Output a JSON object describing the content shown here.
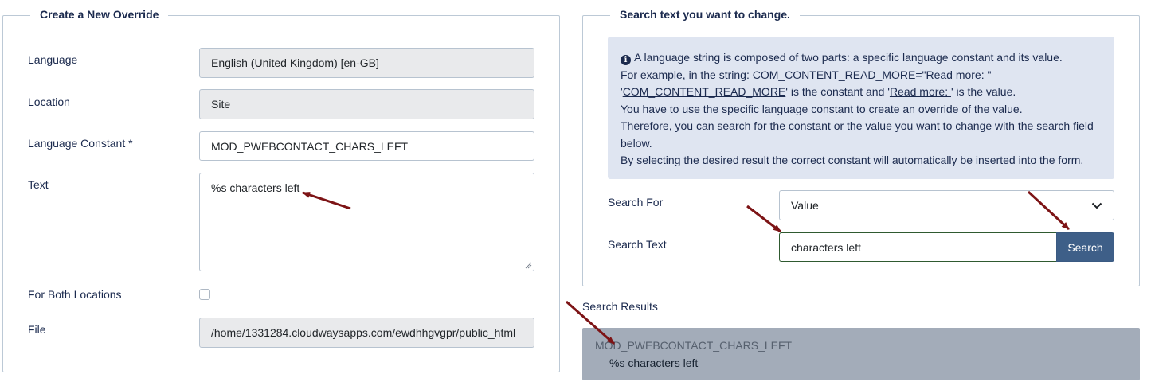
{
  "left_panel": {
    "legend": "Create a New Override",
    "language_label": "Language",
    "language_value": "English (United Kingdom) [en-GB]",
    "location_label": "Location",
    "location_value": "Site",
    "constant_label": "Language Constant *",
    "constant_value": "MOD_PWEBCONTACT_CHARS_LEFT",
    "text_label": "Text",
    "text_value": "%s characters left",
    "both_locations_label": "For Both Locations",
    "both_locations_checked": false,
    "file_label": "File",
    "file_value": "/home/1331284.cloudwaysapps.com/ewdhhgvgpr/public_html"
  },
  "right_panel": {
    "legend": "Search text you want to change.",
    "info": {
      "line1": "A language string is composed of two parts: a specific language constant and its value.",
      "line2": "For example, in the string: COM_CONTENT_READ_MORE=\"Read more: \"",
      "line3_q1": "'",
      "line3_const": "COM_CONTENT_READ_MORE",
      "line3_mid": "' is the constant and '",
      "line3_val": "Read more: ",
      "line3_end": "' is the value.",
      "line4": "You have to use the specific language constant to create an override of the value.",
      "line5": "Therefore, you can search for the constant or the value you want to change with the search field below.",
      "line6": "By selecting the desired result the correct constant will automatically be inserted into the form."
    },
    "search_for_label": "Search For",
    "search_for_value": "Value",
    "search_text_label": "Search Text",
    "search_text_value": "characters left",
    "search_button": "Search"
  },
  "results": {
    "label": "Search Results",
    "items": [
      {
        "constant": "MOD_PWEBCONTACT_CHARS_LEFT",
        "value": "%s characters left"
      }
    ]
  },
  "icons": {
    "info": "info-circle-icon",
    "chevron": "chevron-down-icon",
    "annotation": "red-arrow-annotation"
  },
  "colors": {
    "primary_button": "#3e5f88",
    "info_background": "#dfe5f1",
    "result_background": "#a3acb9",
    "annotation_arrow": "#7d1416"
  }
}
